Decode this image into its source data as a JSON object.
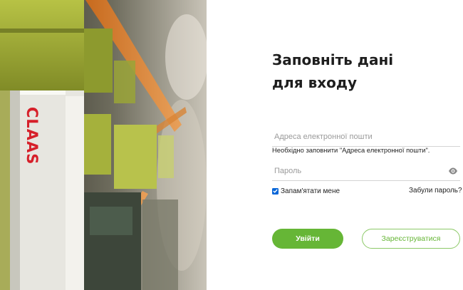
{
  "form": {
    "title_line1": "Заповніть дані",
    "title_line2": "для входу",
    "email_placeholder": "Адреса електронної пошти",
    "email_value": "",
    "email_error": "Необхідно заповнити \"Адреса електронної пошти\".",
    "password_placeholder": "Пароль",
    "password_value": "",
    "password_toggle_icon": "eye-icon",
    "remember_label": "Запам'ятати мене",
    "remember_checked": true,
    "forgot_label": "Забули пароль?",
    "login_label": "Увійти",
    "register_label": "Зареєструватися"
  },
  "photo": {
    "brand_text": "CLAAS",
    "description_icon": "warehouse-shelves-photo"
  },
  "colors": {
    "accent_green": "#66b636",
    "checkbox_blue": "#0a67d8",
    "brand_red": "#d6202a",
    "text_dark": "#1e1e1e"
  }
}
